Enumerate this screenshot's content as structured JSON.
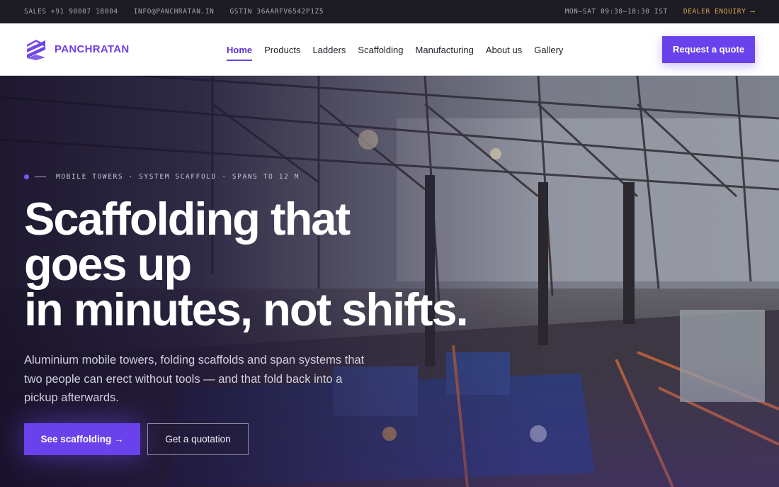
{
  "topbar": {
    "sales": "SALES +91 90007 18004",
    "email": "INFO@PANCHRATAN.IN",
    "gstin": "GSTIN 36AARFV6542P1Z5",
    "hours": "MON–SAT 09:30–18:30 IST",
    "dealer": "DEALER ENQUIRY ⟶"
  },
  "brand": {
    "name": "PANCHRATAN",
    "logo_icon": "panchratan-logo-icon",
    "color": "#6d3fe6"
  },
  "nav": {
    "items": [
      {
        "label": "Home",
        "active": true
      },
      {
        "label": "Products"
      },
      {
        "label": "Ladders"
      },
      {
        "label": "Scaffolding"
      },
      {
        "label": "Manufacturing"
      },
      {
        "label": "About us"
      },
      {
        "label": "Gallery"
      }
    ],
    "cta": "Request a quote"
  },
  "hero": {
    "eyebrow": "MOBILE TOWERS · SYSTEM SCAFFOLD · SPANS TO 12 M",
    "headline": [
      "Scaffolding that",
      "goes up",
      "in minutes, not shifts."
    ],
    "subcopy": "Aluminium mobile towers, folding scaffolds and span systems that two people can erect without tools — and that fold back into a pickup afterwards.",
    "primary_cta": "See scaffolding →",
    "secondary_cta": "Get a quotation",
    "background": "factory-interior-image"
  },
  "colors": {
    "accent": "#6a42ec",
    "topbar_bg": "#1c1b23",
    "dealer_link": "#d9a24a"
  }
}
